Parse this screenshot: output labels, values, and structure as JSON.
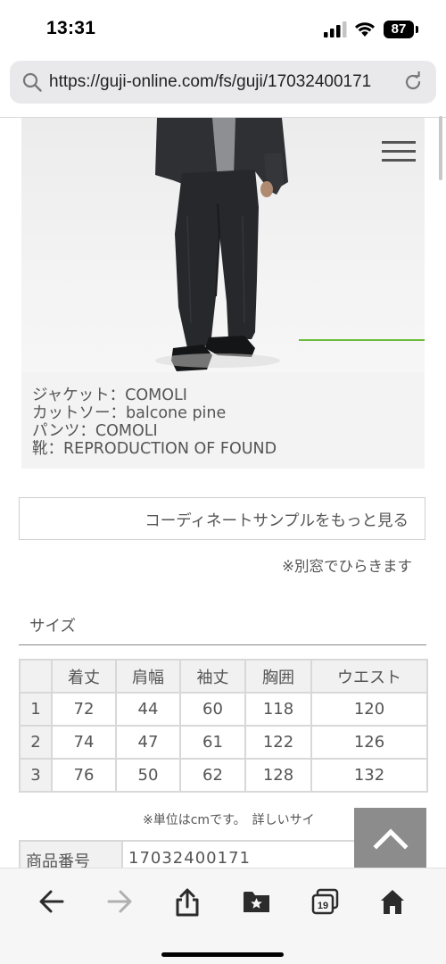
{
  "status_bar": {
    "time": "13:31",
    "battery": "87"
  },
  "browser": {
    "url": "https://guji-online.com/fs/guji/17032400171",
    "tab_count": "19"
  },
  "coordinate": {
    "credits": [
      "ジャケット：COMOLI",
      "カットソー：balcone pine",
      "パンツ：COMOLI",
      "靴：REPRODUCTION OF FOUND"
    ],
    "more_button": "コーディネートサンプルをもっと見る",
    "new_window_note": "※別窓でひらきます"
  },
  "size": {
    "heading": "サイズ",
    "columns": [
      "",
      "着丈",
      "肩幅",
      "袖丈",
      "胸囲",
      "ウエスト"
    ],
    "rows": [
      [
        "1",
        "72",
        "44",
        "60",
        "118",
        "120"
      ],
      [
        "2",
        "74",
        "47",
        "61",
        "122",
        "126"
      ],
      [
        "3",
        "76",
        "50",
        "62",
        "128",
        "132"
      ]
    ],
    "unit_note": "※単位はcmです。　詳しいサイ"
  },
  "product": {
    "number_label": "商品番号",
    "number_value": "17032400171"
  },
  "colors": {
    "accent_line": "#6dbb3c",
    "scroll_button": "#8c8c8c"
  }
}
